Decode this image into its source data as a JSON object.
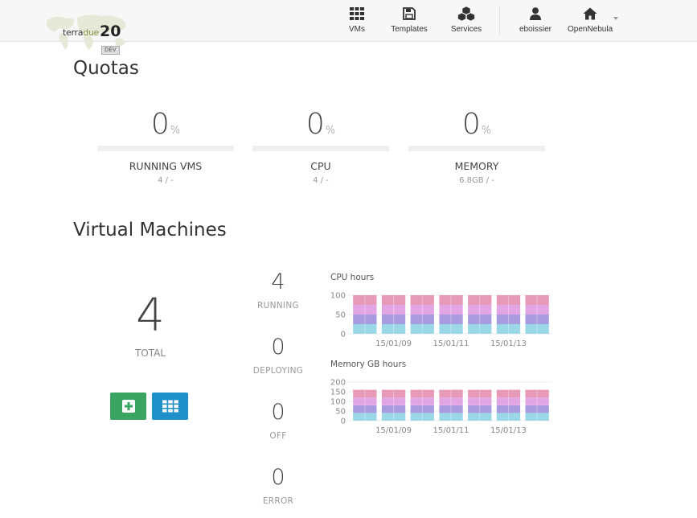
{
  "header": {
    "logo": {
      "brand_a": "terra",
      "brand_b": "due",
      "version": "20",
      "badge": "DEV"
    },
    "nav": [
      {
        "label": "VMs",
        "icon": "grid-icon"
      },
      {
        "label": "Templates",
        "icon": "save-icon"
      },
      {
        "label": "Services",
        "icon": "cubes-icon"
      },
      {
        "label": "eboissier",
        "icon": "user-icon"
      },
      {
        "label": "OpenNebula",
        "icon": "home-icon"
      }
    ]
  },
  "quotas": {
    "title": "Quotas",
    "items": [
      {
        "value": "0",
        "unit": "%",
        "label": "RUNNING VMS",
        "sub": "4 / -",
        "fill": 0
      },
      {
        "value": "0",
        "unit": "%",
        "label": "CPU",
        "sub": "4 / -",
        "fill": 0
      },
      {
        "value": "0",
        "unit": "%",
        "label": "MEMORY",
        "sub": "6.8GB / -",
        "fill": 0
      }
    ]
  },
  "vms": {
    "title": "Virtual Machines",
    "total": "4",
    "total_label": "TOTAL",
    "states": [
      {
        "count": "4",
        "label": "RUNNING"
      },
      {
        "count": "0",
        "label": "DEPLOYING"
      },
      {
        "count": "0",
        "label": "OFF"
      },
      {
        "count": "0",
        "label": "ERROR"
      }
    ],
    "buttons": {
      "create_icon": "plus-icon",
      "list_icon": "grid-icon"
    }
  },
  "colors": {
    "create_button": "#3aa563",
    "list_button": "#1e8fc8",
    "band_1": "#9ad8e8",
    "band_2": "#a99be0",
    "band_3": "#e3a6e4",
    "band_4": "#e79ab8"
  },
  "chart_data": [
    {
      "type": "bar",
      "title": "CPU hours",
      "yticks": [
        "100",
        "50",
        "0"
      ],
      "ylim": [
        0,
        100
      ],
      "xtick_labels": [
        "15/01/09",
        "15/01/11",
        "15/01/13"
      ],
      "bar_count": 7,
      "stack_values": [
        25,
        25,
        25,
        25
      ],
      "colors": [
        "#9ad8e8",
        "#a99be0",
        "#e3a6e4",
        "#e79ab8"
      ]
    },
    {
      "type": "bar",
      "title": "Memory GB hours",
      "yticks": [
        "200",
        "150",
        "100",
        "50",
        "0"
      ],
      "ylim": [
        0,
        200
      ],
      "xtick_labels": [
        "15/01/09",
        "15/01/11",
        "15/01/13"
      ],
      "bar_count": 7,
      "stack_values": [
        40,
        40,
        40,
        40
      ],
      "colors": [
        "#9ad8e8",
        "#a99be0",
        "#e3a6e4",
        "#e79ab8"
      ]
    }
  ]
}
